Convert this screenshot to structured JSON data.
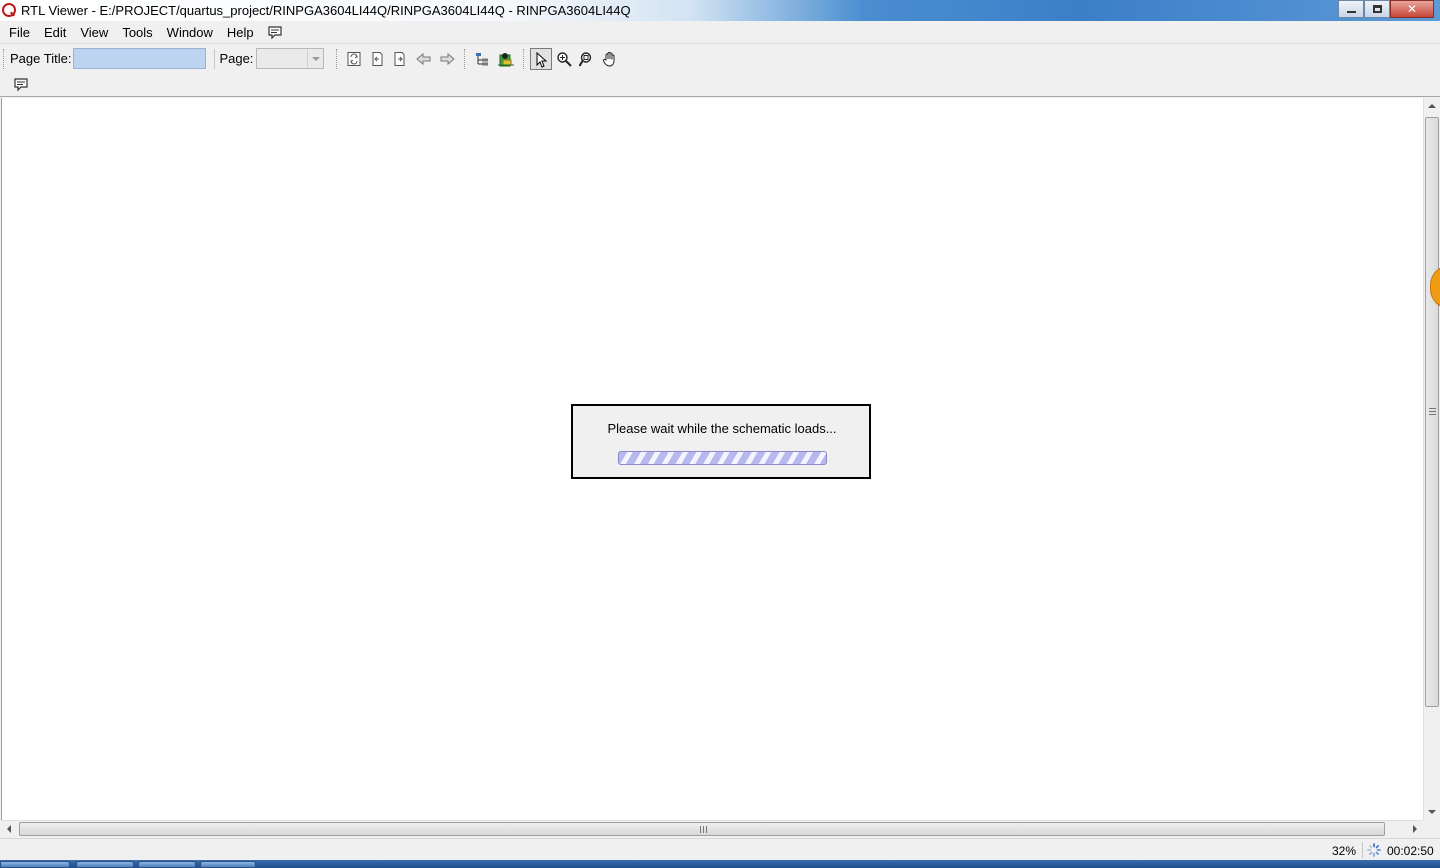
{
  "window": {
    "title": "RTL Viewer - E:/PROJECT/quartus_project/RINPGA3604LI44Q/RINPGA3604LI44Q - RINPGA3604LI44Q"
  },
  "menu": {
    "items": [
      "File",
      "Edit",
      "View",
      "Tools",
      "Window",
      "Help"
    ]
  },
  "toolbar": {
    "page_title_label": "Page Title:",
    "page_title_value": "",
    "page_label": "Page:",
    "page_value": ""
  },
  "dialog": {
    "message": "Please wait while the schematic loads..."
  },
  "statusbar": {
    "zoom": "32%",
    "elapsed": "00:02:50"
  },
  "colors": {
    "progress_stripe": "#b7b8ee",
    "page_title_field": "#bcd4f0",
    "side_tab": "#f19b14"
  }
}
